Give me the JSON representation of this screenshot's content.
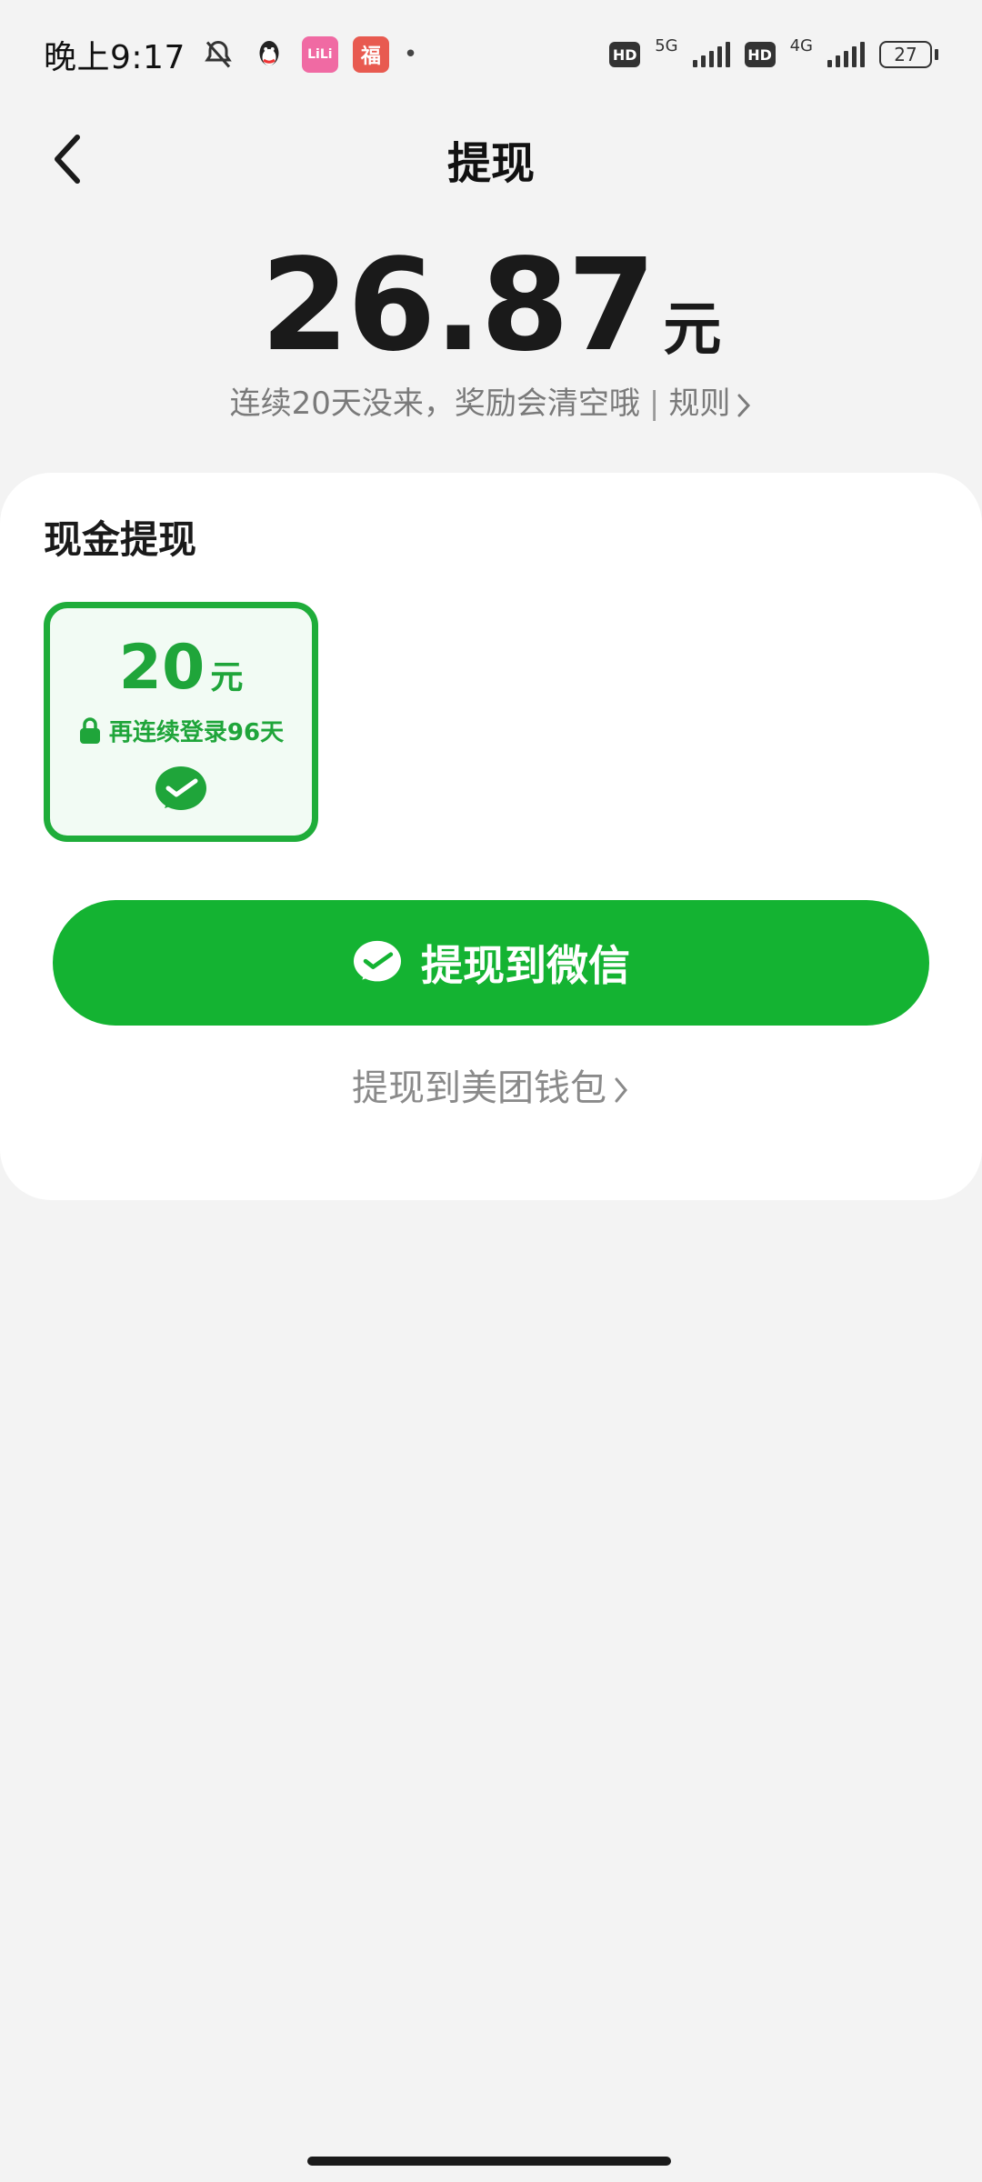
{
  "status_bar": {
    "time": "晚上9:17",
    "net1": "5G",
    "net2": "4G",
    "hd": "HD",
    "battery": "27",
    "pink_app_text": "LiLi",
    "red_app_text": "福"
  },
  "header": {
    "title": "提现"
  },
  "balance": {
    "amount": "26.87",
    "unit": "元",
    "notice": "连续20天没来，奖励会清空哦",
    "separator": "|",
    "rule_link": "规则"
  },
  "cash_section": {
    "title": "现金提现",
    "option": {
      "amount": "20",
      "unit": "元",
      "lock_text": "再连续登录96天"
    }
  },
  "actions": {
    "wechat_button": "提现到微信",
    "meituan_link": "提现到美团钱包"
  },
  "colors": {
    "brand_green": "#14b332",
    "option_border": "#1fad3a",
    "option_bg": "#f2fbf4"
  }
}
